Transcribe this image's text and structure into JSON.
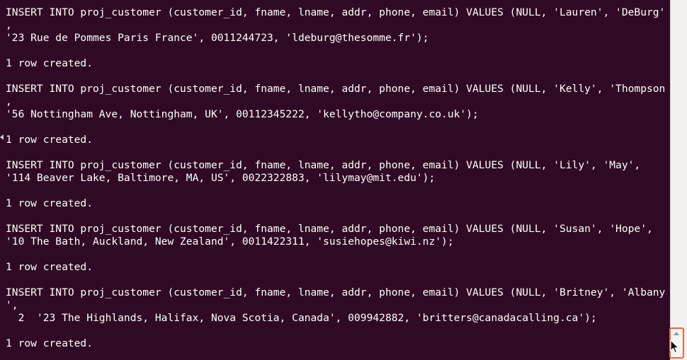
{
  "terminal": {
    "lines": [
      "INSERT INTO proj_customer (customer_id, fname, lname, addr, phone, email) VALUES (NULL, 'Lauren', 'DeBurg'",
      ",",
      "'23 Rue de Pommes Paris France', 0011244723, 'ldeburg@thesomme.fr');",
      "",
      "1 row created.",
      "",
      "INSERT INTO proj_customer (customer_id, fname, lname, addr, phone, email) VALUES (NULL, 'Kelly', 'Thompson",
      ",",
      "'56 Nottingham Ave, Nottingham, UK', 00112345222, 'kellytho@company.co.uk');",
      "",
      "1 row created.",
      "",
      "INSERT INTO proj_customer (customer_id, fname, lname, addr, phone, email) VALUES (NULL, 'Lily', 'May',",
      "'114 Beaver Lake, Baltimore, MA, US', 0022322883, 'lilymay@mit.edu');",
      "",
      "1 row created.",
      "",
      "INSERT INTO proj_customer (customer_id, fname, lname, addr, phone, email) VALUES (NULL, 'Susan', 'Hope',",
      "'10 The Bath, Auckland, New Zealand', 0011422311, 'susiehopes@kiwi.nz');",
      "",
      "1 row created.",
      "",
      "INSERT INTO proj_customer (customer_id, fname, lname, addr, phone, email) VALUES (NULL, 'Britney', 'Albany",
      "',",
      "  2  '23 The Highlands, Halifax, Nova Scotia, Canada', 009942882, 'britters@canadacalling.ca');",
      "",
      "1 row created."
    ]
  },
  "scrollbar": {
    "position_fraction": 1.0,
    "thumb_highlight_color": "#e26a3e",
    "up_arrow_icon": "triangle-up"
  },
  "cursor": {
    "icon": "mouse-pointer-icon"
  },
  "colors": {
    "background": "#300a24",
    "text": "#ffffff"
  }
}
